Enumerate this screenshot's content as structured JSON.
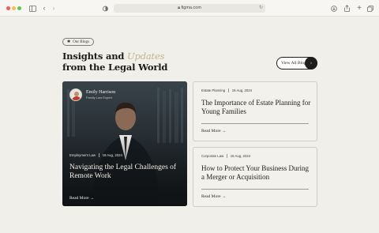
{
  "browser": {
    "url": "figma.com",
    "icons": [
      "sidebar-icon",
      "back-arrow-icon",
      "forward-arrow-icon",
      "shield-icon",
      "lock-icon",
      "reload-icon",
      "download-icon",
      "share-icon",
      "new-tab-icon",
      "tabs-icon"
    ]
  },
  "section": {
    "chip_label": "Our Blogs",
    "heading_line1": "Insights and",
    "heading_accent": "Updates",
    "heading_line2": "from the Legal World",
    "view_all_label": "View All Blogs"
  },
  "featured": {
    "author_name": "Emily Harrison",
    "author_role": "Family Law Expert",
    "category": "Employment Law",
    "date": "18 Aug, 2024",
    "title": "Navigating the Legal Challenges of Remote Work",
    "read_more": "Read More"
  },
  "cards": [
    {
      "category": "Estate Planning",
      "date": "16 Aug, 2024",
      "title": "The Importance of Estate Planning for Young Families",
      "read_more": "Read More"
    },
    {
      "category": "Corporate Law",
      "date": "15 Aug, 2024",
      "title": "How to Protect Your Business During a Merger or Acquisition",
      "read_more": "Read More"
    }
  ],
  "colors": {
    "page_bg": "#f1efea",
    "accent_gold": "#c5b48a",
    "dark": "#1e1e1e"
  }
}
